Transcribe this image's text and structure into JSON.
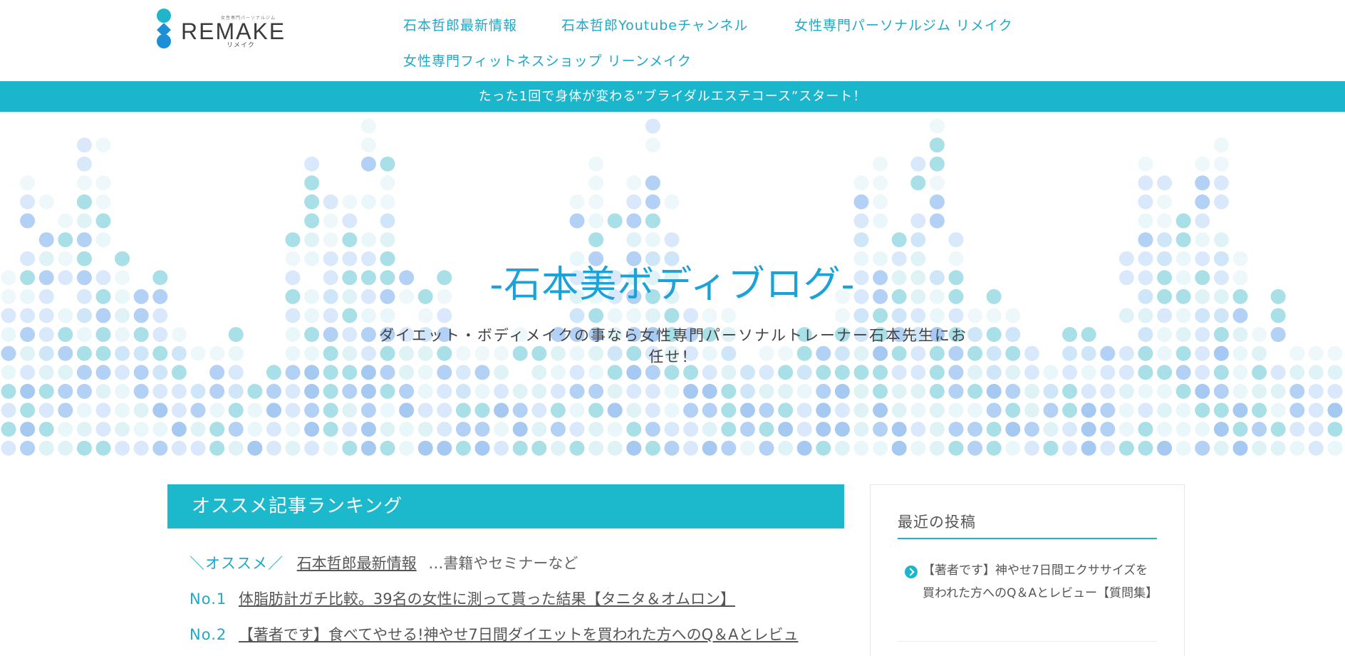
{
  "header": {
    "logo": {
      "wordmark": "REMAKE",
      "kana": "リメイク",
      "tagline": "女性専門パーソナルジム"
    },
    "nav": [
      {
        "label": "石本哲郎最新情報"
      },
      {
        "label": "石本哲郎Youtubeチャンネル"
      },
      {
        "label": "女性専門パーソナルジム リメイク"
      },
      {
        "label": "女性専門フィットネスショップ リーンメイク"
      }
    ]
  },
  "banner": {
    "text": "たった1回で身体が変わる”ブライダルエステコース”スタート！"
  },
  "hero": {
    "title": "-石本美ボディブログ-",
    "subtitle": "ダイエット・ボディメイクの事なら女性専門パーソナルトレーナー石本先生にお任せ！"
  },
  "main": {
    "ranking_title": "オススメ記事ランキング",
    "recommend": {
      "prefix": "＼オススメ／",
      "link": "石本哲郎最新情報",
      "suffix": "…書籍やセミナーなど"
    },
    "items": [
      {
        "rank": "No.1",
        "title": "体脂肪計ガチ比較。39名の女性に測って貰った結果【タニタ＆オムロン】"
      },
      {
        "rank": "No.2",
        "title": "【著者です】食べてやせる!神やせ7日間ダイエットを買われた方へのQ＆Aとレビュ"
      }
    ]
  },
  "sidebar": {
    "title": "最近の投稿",
    "posts": [
      {
        "title": "【著者です】神やせ7日間エクササイズを買われた方へのQ＆Aとレビュー【質問集】"
      }
    ]
  },
  "colors": {
    "accent": "#1cb6cc",
    "link": "#1fa8c8",
    "hero_title": "#1ba2d8"
  },
  "icons": [
    "circle-chevron-right-icon"
  ]
}
